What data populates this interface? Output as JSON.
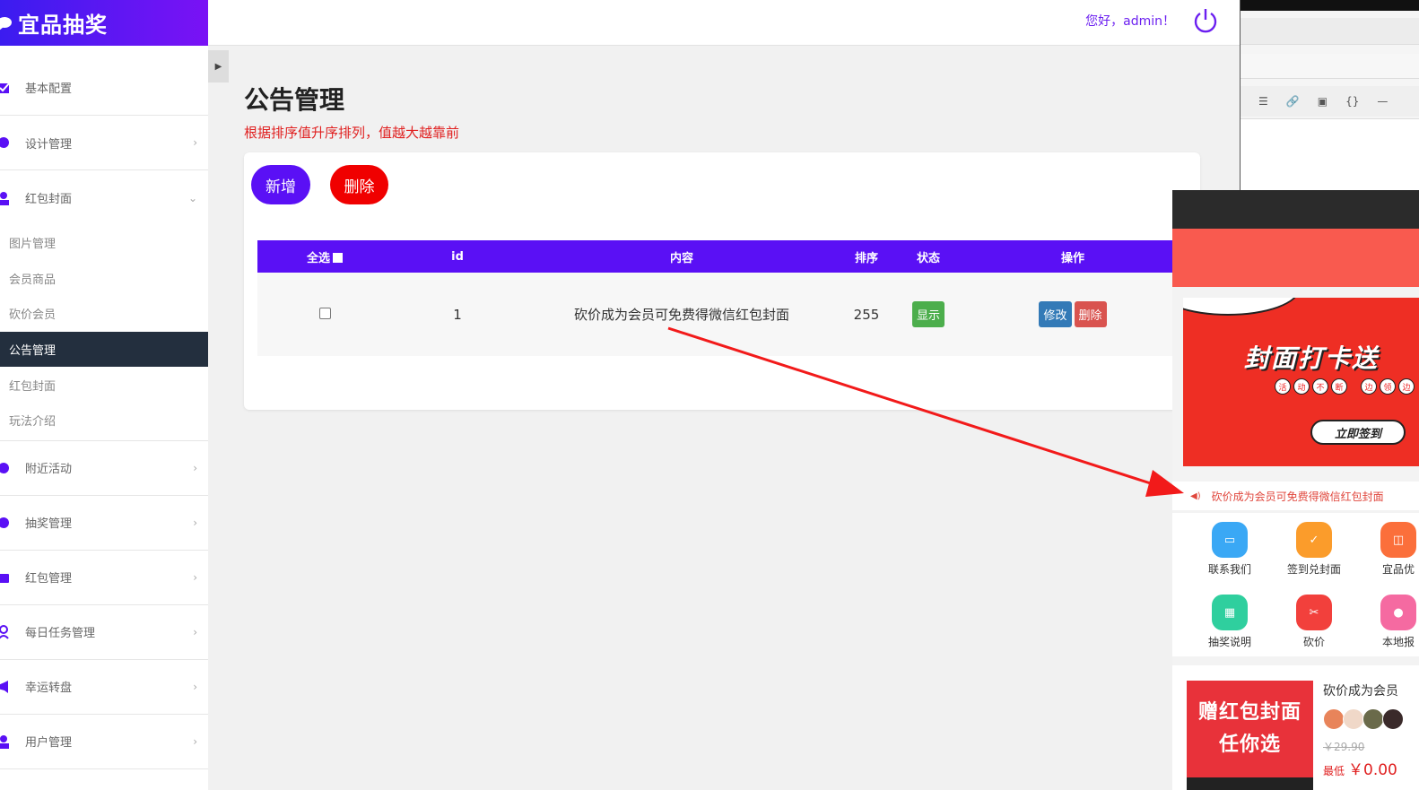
{
  "app": {
    "logo_text": "宜品抽奖"
  },
  "header": {
    "greeting": "您好，admin！"
  },
  "sidebar": {
    "items": [
      {
        "label": "基本配置"
      },
      {
        "label": "设计管理"
      },
      {
        "label": "红包封面"
      },
      {
        "label": "附近活动"
      },
      {
        "label": "抽奖管理"
      },
      {
        "label": "红包管理"
      },
      {
        "label": "每日任务管理"
      },
      {
        "label": "幸运转盘"
      },
      {
        "label": "用户管理"
      }
    ],
    "submenu": [
      {
        "label": "图片管理"
      },
      {
        "label": "会员商品"
      },
      {
        "label": "砍价会员"
      },
      {
        "label": "公告管理",
        "active": true
      },
      {
        "label": "红包封面"
      },
      {
        "label": "玩法介绍"
      }
    ]
  },
  "main": {
    "title": "公告管理",
    "subtitle": "根据排序值升序排列，值越大越靠前",
    "add_label": "新增",
    "delete_label": "删除",
    "table": {
      "headers": [
        "全选",
        "id",
        "内容",
        "排序",
        "状态",
        "操作"
      ],
      "rows": [
        {
          "id": "1",
          "content": "砍价成为会员可免费得微信红包封面",
          "sort": "255",
          "status": "显示",
          "edit": "修改",
          "delete": "删除"
        }
      ]
    }
  },
  "preview": {
    "banner_title": "封面打卡送",
    "banner_dots": [
      "活",
      "动",
      "不",
      "断",
      "边",
      "领",
      "边"
    ],
    "banner_button": "立即签到",
    "notice": "砍价成为会员可免费得微信红包封面",
    "grid": [
      {
        "label": "联系我们",
        "icon": "chat-icon",
        "color": "#3aa8f5"
      },
      {
        "label": "签到兑封面",
        "icon": "calendar-icon",
        "color": "#fb9c2b"
      },
      {
        "label": "宜品优",
        "icon": "bag-icon",
        "color": "#fb6f3b"
      },
      {
        "label": "抽奖说明",
        "icon": "gift-icon",
        "color": "#2fcf9e"
      },
      {
        "label": "砍价",
        "icon": "cut-icon",
        "color": "#f2403c"
      },
      {
        "label": "本地报",
        "icon": "location-icon",
        "color": "#f56aa1"
      }
    ],
    "product": {
      "image_text_1": "赠红包封面",
      "image_text_2": "任你选",
      "title": "砍价成为会员",
      "old_price": "￥29.90",
      "price_prefix": "最低",
      "price": "￥0.00"
    }
  },
  "colors": {
    "accent": "#5a10f5",
    "danger": "#f00000",
    "sidebar_active": "#232f3e"
  }
}
